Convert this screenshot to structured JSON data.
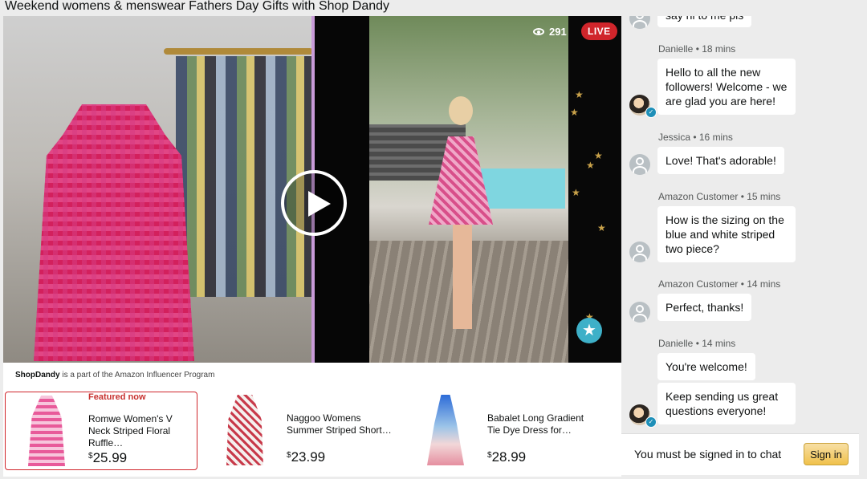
{
  "page": {
    "title": "Weekend womens & menswear Fathers Day Gifts with Shop Dandy"
  },
  "video": {
    "viewers": "291",
    "live_label": "LIVE"
  },
  "influencer": {
    "brand": "ShopDandy",
    "note": " is a part of the Amazon Influencer Program"
  },
  "products": [
    {
      "featured_label": "Featured now",
      "name": "Romwe Women's V Neck Striped Floral Ruffle…",
      "currency": "$",
      "price": "25.99"
    },
    {
      "name": "Naggoo Womens Summer Striped Short…",
      "currency": "$",
      "price": "23.99"
    },
    {
      "name": "Babalet Long Gradient Tie Dye Dress for…",
      "currency": "$",
      "price": "28.99"
    }
  ],
  "chat": {
    "partial_message": "say hi to me pls",
    "messages": [
      {
        "author": "Danielle • 18 mins",
        "text": "Hello to all the new followers! Welcome - we are glad you are here!"
      },
      {
        "author": "Jessica • 16 mins",
        "text": "Love! That's adorable!"
      },
      {
        "author": "Amazon Customer • 15 mins",
        "text": "How is the sizing on the blue and white striped two piece?"
      },
      {
        "author": "Amazon Customer • 14 mins",
        "text": "Perfect, thanks!"
      },
      {
        "author": "Danielle • 14 mins",
        "text": "You're welcome!"
      },
      {
        "text": "Keep sending us great questions everyone!"
      }
    ],
    "signin_prompt": "You must be signed in to chat",
    "signin_label": "Sign in"
  },
  "colors": {
    "live": "#d0252b",
    "featured_border": "#d0252b",
    "signin_button": "#f0c14b",
    "favorite": "#3eb0c8"
  }
}
